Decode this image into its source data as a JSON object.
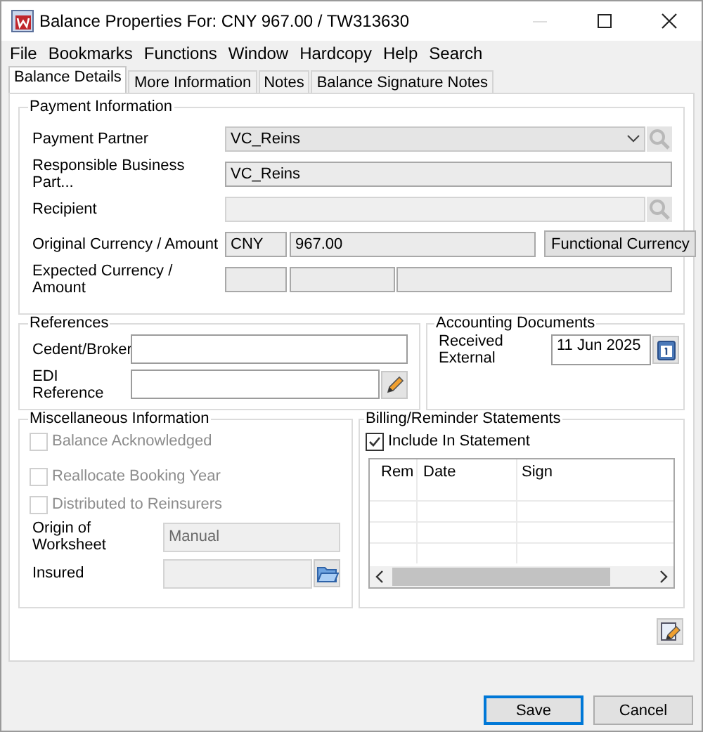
{
  "window": {
    "title": "Balance Properties For: CNY 967.00 / TW313630"
  },
  "menu": [
    "File",
    "Bookmarks",
    "Functions",
    "Window",
    "Hardcopy",
    "Help",
    "Search"
  ],
  "tabs": [
    {
      "label": "Balance Details",
      "selected": true
    },
    {
      "label": "More Information",
      "selected": false
    },
    {
      "label": "Notes",
      "selected": false
    },
    {
      "label": "Balance Signature Notes",
      "selected": false
    }
  ],
  "payment_information": {
    "title": "Payment Information",
    "fields": [
      {
        "kind": "combo",
        "label": "Payment Partner",
        "value": "VC_Reins"
      },
      {
        "kind": "text",
        "label": "Responsible Business Part...",
        "value": "VC_Reins"
      },
      {
        "kind": "lookup",
        "label": "Recipient"
      },
      {
        "kind": "currency",
        "label": "Original Currency / Amount",
        "currency": "CNY",
        "amount": "967.00",
        "button": "Functional Currency"
      },
      {
        "kind": "triple",
        "label": "Expected Currency / Amount"
      }
    ]
  },
  "references": {
    "title": "References",
    "fields": [
      {
        "kind": "text",
        "label": "Cedent/Broker"
      },
      {
        "kind": "edit",
        "label": "EDI Reference"
      }
    ]
  },
  "accounting_documents": {
    "title": "Accounting Documents",
    "label": "Received External",
    "value": "11 Jun 2025"
  },
  "miscellaneous_information": {
    "title": "Miscellaneous Information",
    "checkboxes": [
      {
        "label": "Balance Acknowledged",
        "checked": false,
        "disabled": true
      },
      {
        "label": "Reallocate Booking Year",
        "checked": false,
        "disabled": true
      },
      {
        "label": "Distributed to Reinsurers",
        "checked": false,
        "disabled": true
      }
    ],
    "fields": [
      {
        "kind": "text",
        "label": "Origin of Worksheet",
        "value": "Manual"
      },
      {
        "kind": "folder",
        "label": "Insured"
      }
    ]
  },
  "billing_reminder_statements": {
    "title": "Billing/Reminder Statements",
    "include": {
      "label": "Include In Statement",
      "checked": true
    },
    "columns": [
      "Rem",
      "Date",
      "Sign"
    ]
  },
  "buttons": [
    {
      "label": "Save",
      "default": true
    },
    {
      "label": "Cancel",
      "default": false
    }
  ]
}
